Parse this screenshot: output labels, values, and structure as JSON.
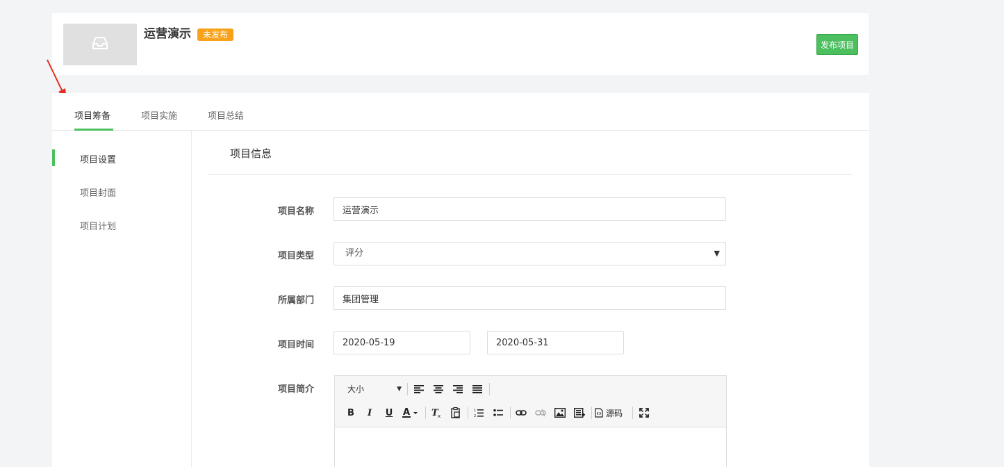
{
  "header": {
    "project_title": "运营演示",
    "status_badge": "未发布",
    "publish_button": "发布项目",
    "cover_icon": "inbox-icon"
  },
  "tabs": [
    {
      "label": "项目筹备",
      "active": true
    },
    {
      "label": "项目实施",
      "active": false
    },
    {
      "label": "项目总结",
      "active": false
    }
  ],
  "sidebar": {
    "items": [
      {
        "label": "项目设置",
        "active": true
      },
      {
        "label": "项目封面",
        "active": false
      },
      {
        "label": "项目计划",
        "active": false
      }
    ]
  },
  "section": {
    "title": "项目信息"
  },
  "form": {
    "name": {
      "label": "项目名称",
      "value": "运营演示"
    },
    "type": {
      "label": "项目类型",
      "value": "评分"
    },
    "department": {
      "label": "所属部门",
      "value": "集团管理"
    },
    "time": {
      "label": "项目时间",
      "start": "2020-05-19",
      "end": "2020-05-31"
    },
    "intro": {
      "label": "项目简介"
    }
  },
  "editor": {
    "size_label": "大小",
    "source_label": "源码"
  },
  "colors": {
    "accent": "#4cbf5f",
    "badge": "#f7a21a",
    "arrow": "#e62d1f"
  }
}
